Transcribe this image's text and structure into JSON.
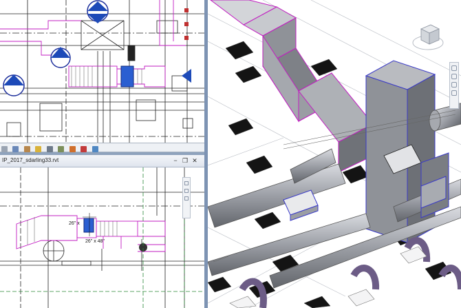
{
  "plan_bottom": {
    "title": "IP_2017_sdarling33.rvt",
    "minimize": "−",
    "restore": "❐",
    "close": "✕",
    "dim_label_1": "26\" x",
    "dim_label_2": "26\" x 48\""
  },
  "view_cube": {
    "label": "cube-icon"
  },
  "colors": {
    "accent_magenta": "#c21cc2",
    "selection_blue": "#2b5fd1",
    "duct_gray": "#8c8f96",
    "bg_blue": "#c9d3df"
  }
}
